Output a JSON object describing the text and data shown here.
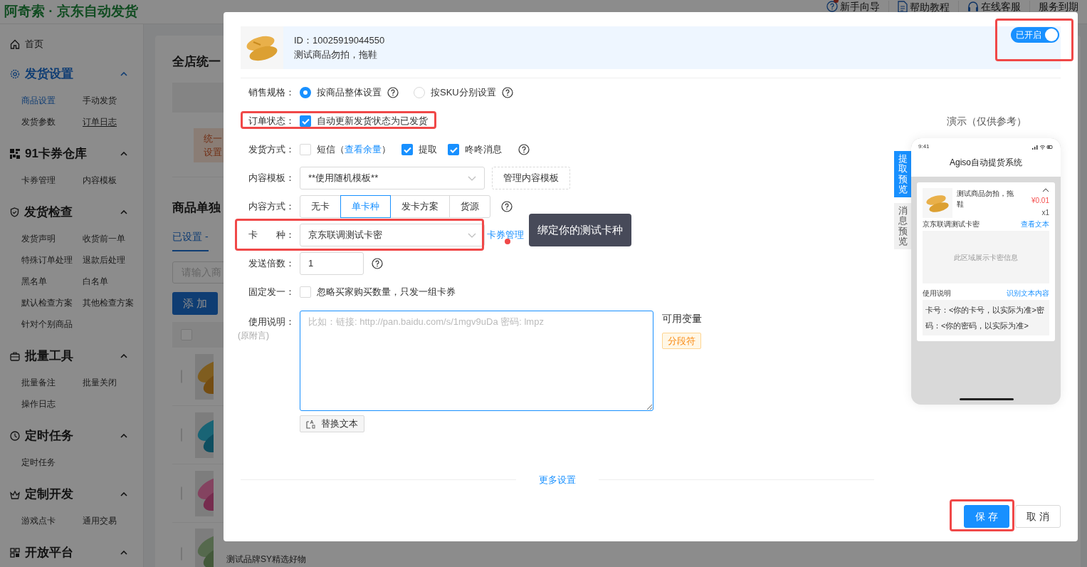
{
  "app": {
    "title": "阿奇索 · 京东自动发货",
    "header_links": [
      {
        "label": "新手向导",
        "badge": true
      },
      {
        "label": "帮助教程",
        "badge": false
      },
      {
        "label": "在线客服",
        "badge": false
      },
      {
        "label": "服务到期",
        "badge": false
      }
    ]
  },
  "sidebar": {
    "home": "首页",
    "sections": [
      {
        "title": "发货设置",
        "expanded": true,
        "selected": true,
        "items": [
          {
            "label": "商品设置",
            "selected": true,
            "hovered": false
          },
          {
            "label": "手动发货",
            "selected": false,
            "hovered": false
          },
          {
            "label": "发货参数",
            "selected": false,
            "hovered": false
          },
          {
            "label": "订单日志",
            "selected": false,
            "hovered": true
          }
        ]
      },
      {
        "title": "91卡券仓库",
        "expanded": true,
        "selected": false,
        "items": [
          {
            "label": "卡券管理",
            "selected": false,
            "hovered": false
          },
          {
            "label": "内容模板",
            "selected": false,
            "hovered": false
          }
        ]
      },
      {
        "title": "发货检查",
        "expanded": true,
        "selected": false,
        "items": [
          {
            "label": "发货声明",
            "selected": false,
            "hovered": false
          },
          {
            "label": "收货前一单",
            "selected": false,
            "hovered": false
          },
          {
            "label": "特殊订单处理",
            "selected": false,
            "hovered": false
          },
          {
            "label": "退款后处理",
            "selected": false,
            "hovered": false
          },
          {
            "label": "黑名单",
            "selected": false,
            "hovered": false
          },
          {
            "label": "白名单",
            "selected": false,
            "hovered": false
          },
          {
            "label": "默认检查方案",
            "selected": false,
            "hovered": false
          },
          {
            "label": "其他检查方案",
            "selected": false,
            "hovered": false
          },
          {
            "label": "针对个别商品",
            "selected": false,
            "hovered": false
          }
        ]
      },
      {
        "title": "批量工具",
        "expanded": true,
        "selected": false,
        "items": [
          {
            "label": "批量备注",
            "selected": false,
            "hovered": false
          },
          {
            "label": "批量关闭",
            "selected": false,
            "hovered": false
          },
          {
            "label": "操作日志",
            "selected": false,
            "hovered": false
          }
        ]
      },
      {
        "title": "定时任务",
        "expanded": true,
        "selected": false,
        "items": [
          {
            "label": "定时任务",
            "selected": false,
            "hovered": false
          }
        ]
      },
      {
        "title": "定制开发",
        "expanded": true,
        "selected": false,
        "items": [
          {
            "label": "游戏点卡",
            "selected": false,
            "hovered": false
          },
          {
            "label": "通用交易",
            "selected": false,
            "hovered": false
          }
        ]
      },
      {
        "title": "开放平台",
        "expanded": true,
        "selected": false
      }
    ]
  },
  "main": {
    "section_title": "全店统一",
    "notice": [
      "统一",
      "设置"
    ],
    "list_title": "商品单独",
    "tab": "已设置 -",
    "search": {
      "placeholder": "请输入商"
    },
    "add_button": "添 加",
    "header_checked": false,
    "rows": [
      {
        "kind": "picture",
        "checked": false
      },
      {
        "kind": "picture",
        "checked": false
      },
      {
        "kind": "picture",
        "checked": false
      },
      {
        "kind": "picture",
        "checked": false,
        "text": "测试品牌SY精选好物"
      }
    ]
  },
  "dialog": {
    "product": {
      "id": "ID：10025919044550",
      "name": "测试商品勿拍，拖鞋",
      "toggle": {
        "label": "已开启",
        "on": true,
        "highlighted": true
      }
    },
    "rows": [
      {
        "kind": "radio",
        "label": "销售规格：",
        "highlighted": false,
        "options": [
          {
            "label": "按商品整体设置",
            "selected": true
          },
          {
            "label": "按SKU分别设置",
            "selected": false
          }
        ]
      },
      {
        "kind": "checkbox",
        "label": "订单状态：",
        "highlighted": true,
        "options": [
          {
            "label": "自动更新发货状态为已发货",
            "checked": true
          }
        ]
      },
      {
        "kind": "checkbox",
        "label": "发货方式：",
        "highlighted": false,
        "help": true,
        "options": [
          {
            "label": "短信（",
            "link": "查看余量",
            "suffix": "）",
            "checked": false
          },
          {
            "label": "提取",
            "checked": true
          },
          {
            "label": "咚咚消息",
            "checked": true
          }
        ]
      },
      {
        "kind": "select",
        "label": "内容模板：",
        "highlighted": false,
        "value": "**使用随机模板**",
        "button": "管理内容模板"
      },
      {
        "kind": "segmented",
        "label": "内容方式：",
        "highlighted": false,
        "help": true,
        "options": [
          {
            "label": "无卡",
            "selected": false
          },
          {
            "label": "单卡种",
            "selected": true
          },
          {
            "label": "发卡方案",
            "selected": false
          },
          {
            "label": "货源",
            "selected": false
          }
        ]
      },
      {
        "kind": "select",
        "label": "卡　　种：",
        "highlighted": true,
        "value": "京东联调测试卡密",
        "link": "卡券管理",
        "tooltip": "绑定你的测试卡种"
      },
      {
        "kind": "number",
        "label": "发送倍数：",
        "highlighted": false,
        "help": true,
        "value": "1"
      },
      {
        "kind": "checkbox",
        "label": "固定发一：",
        "highlighted": false,
        "options": [
          {
            "label": "忽略买家购买数量，只发一组卡券",
            "checked": false
          }
        ]
      },
      {
        "kind": "textarea",
        "label": "使用说明：",
        "sublabel": "(原附言)",
        "highlighted": false,
        "placeholder": "比如：链接: http://pan.baidu.com/s/1mgv9uDa 密码: lmpz",
        "variables_title": "可用变量",
        "variables": [
          "分段符"
        ],
        "button": "替换文本"
      }
    ],
    "more_settings": "更多设置",
    "preview": {
      "title": "演示（仅供参考）",
      "tabs": [
        {
          "label": "提取预览",
          "selected": true
        },
        {
          "label": "消息预览",
          "selected": false
        }
      ],
      "phone": {
        "time": "9:41",
        "app_title": "Agiso自动提货系统",
        "product_name": "测试商品勿拍，拖鞋",
        "price": "¥0.01",
        "quantity": "x1",
        "card_title": "京东联调测试卡密",
        "card_link": "查看文本",
        "card_placeholder": "此区域展示卡密信息",
        "usage_title": "使用说明",
        "usage_link": "识别文本内容",
        "usage_text": "卡号：<你的卡号，以实际为准>密码：<你的密码，以实际为准>"
      }
    },
    "buttons": [
      {
        "kind": "primary",
        "label": "保 存",
        "highlighted": true
      },
      {
        "kind": "default",
        "label": "取 消",
        "highlighted": false
      }
    ]
  }
}
